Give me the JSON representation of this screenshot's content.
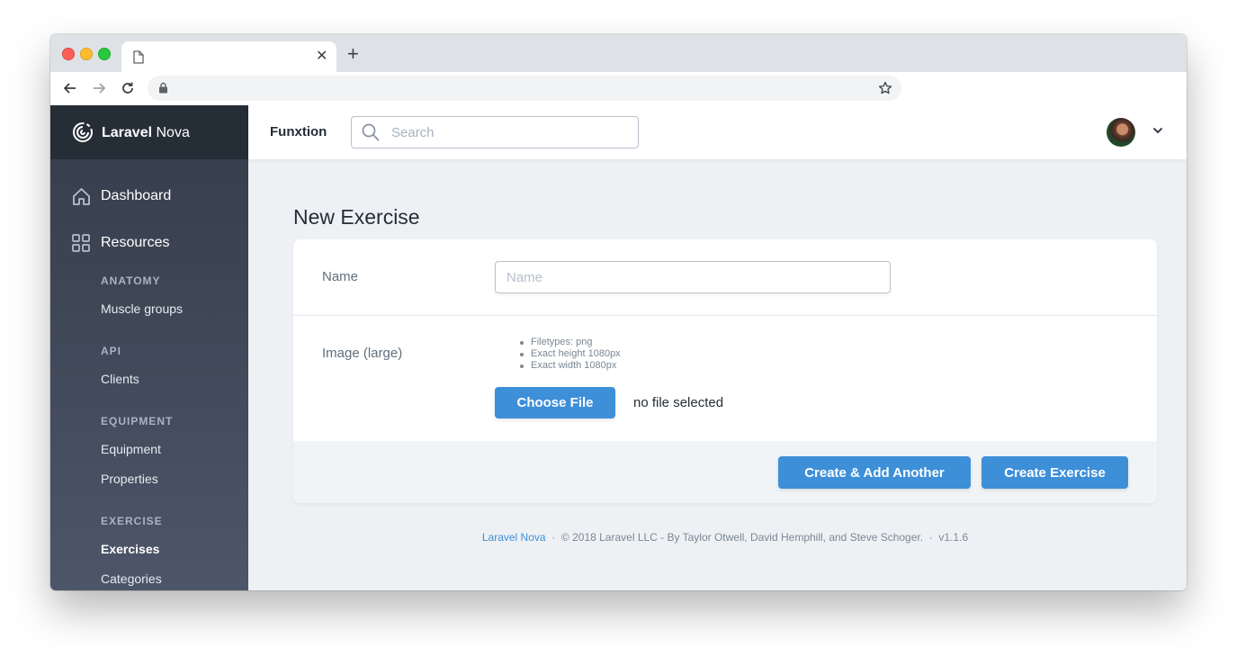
{
  "sidebar": {
    "brand_bold": "Laravel",
    "brand_rest": " Nova",
    "dashboard": "Dashboard",
    "resources": "Resources",
    "groups": [
      {
        "title": "ANATOMY",
        "items": [
          "Muscle groups"
        ]
      },
      {
        "title": "API",
        "items": [
          "Clients"
        ]
      },
      {
        "title": "EQUIPMENT",
        "items": [
          "Equipment",
          "Properties"
        ]
      },
      {
        "title": "EXERCISE",
        "items": [
          "Exercises",
          "Categories"
        ]
      }
    ],
    "active_item": "Exercises"
  },
  "header": {
    "app_name": "Funxtion",
    "search_placeholder": "Search"
  },
  "form": {
    "title": "New Exercise",
    "name_label": "Name",
    "name_placeholder": "Name",
    "image_label": "Image (large)",
    "rules": [
      "Filetypes: png",
      "Exact height 1080px",
      "Exact width 1080px"
    ],
    "choose_file": "Choose File",
    "no_file": "no file selected",
    "create_another": "Create & Add Another",
    "create": "Create Exercise"
  },
  "footer": {
    "link": "Laravel Nova",
    "sep1": "·",
    "copyright": "© 2018 Laravel LLC - By Taylor Otwell, David Hemphill, and Steve Schoger.",
    "sep2": "·",
    "version": "v1.1.6"
  },
  "colors": {
    "accent": "#3d8fd8",
    "sidebar_top": "#353c4a",
    "sidebar_bottom": "#4c5668",
    "brand_bg": "#252d37",
    "page_bg": "#eef1f4"
  }
}
